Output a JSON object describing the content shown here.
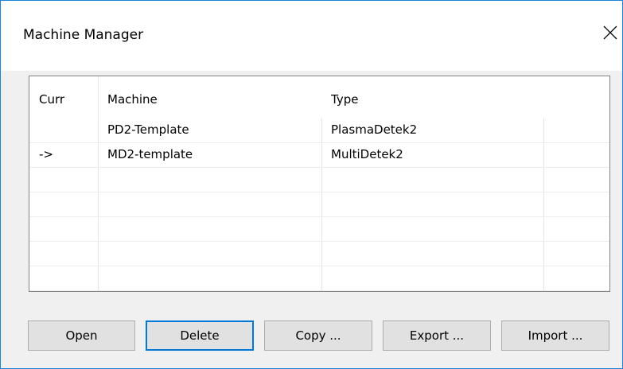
{
  "window": {
    "title": "Machine Manager"
  },
  "table": {
    "columns": [
      "Curr",
      "Machine",
      "Type",
      ""
    ],
    "rows": [
      {
        "curr": "",
        "machine": "PD2-Template",
        "type": "PlasmaDetek2"
      },
      {
        "curr": "->",
        "machine": "MD2-template",
        "type": "MultiDetek2"
      },
      {
        "curr": "",
        "machine": "",
        "type": ""
      },
      {
        "curr": "",
        "machine": "",
        "type": ""
      },
      {
        "curr": "",
        "machine": "",
        "type": ""
      },
      {
        "curr": "",
        "machine": "",
        "type": ""
      },
      {
        "curr": "",
        "machine": "",
        "type": ""
      }
    ]
  },
  "buttons": {
    "open": "Open",
    "delete": "Delete",
    "copy": "Copy ...",
    "export": "Export ...",
    "import": "Import ..."
  },
  "colors": {
    "window_border": "#1883d7",
    "default_button_border": "#0078d7",
    "dialog_background": "#f0f0f0"
  },
  "icons": {
    "close": "close-icon"
  }
}
